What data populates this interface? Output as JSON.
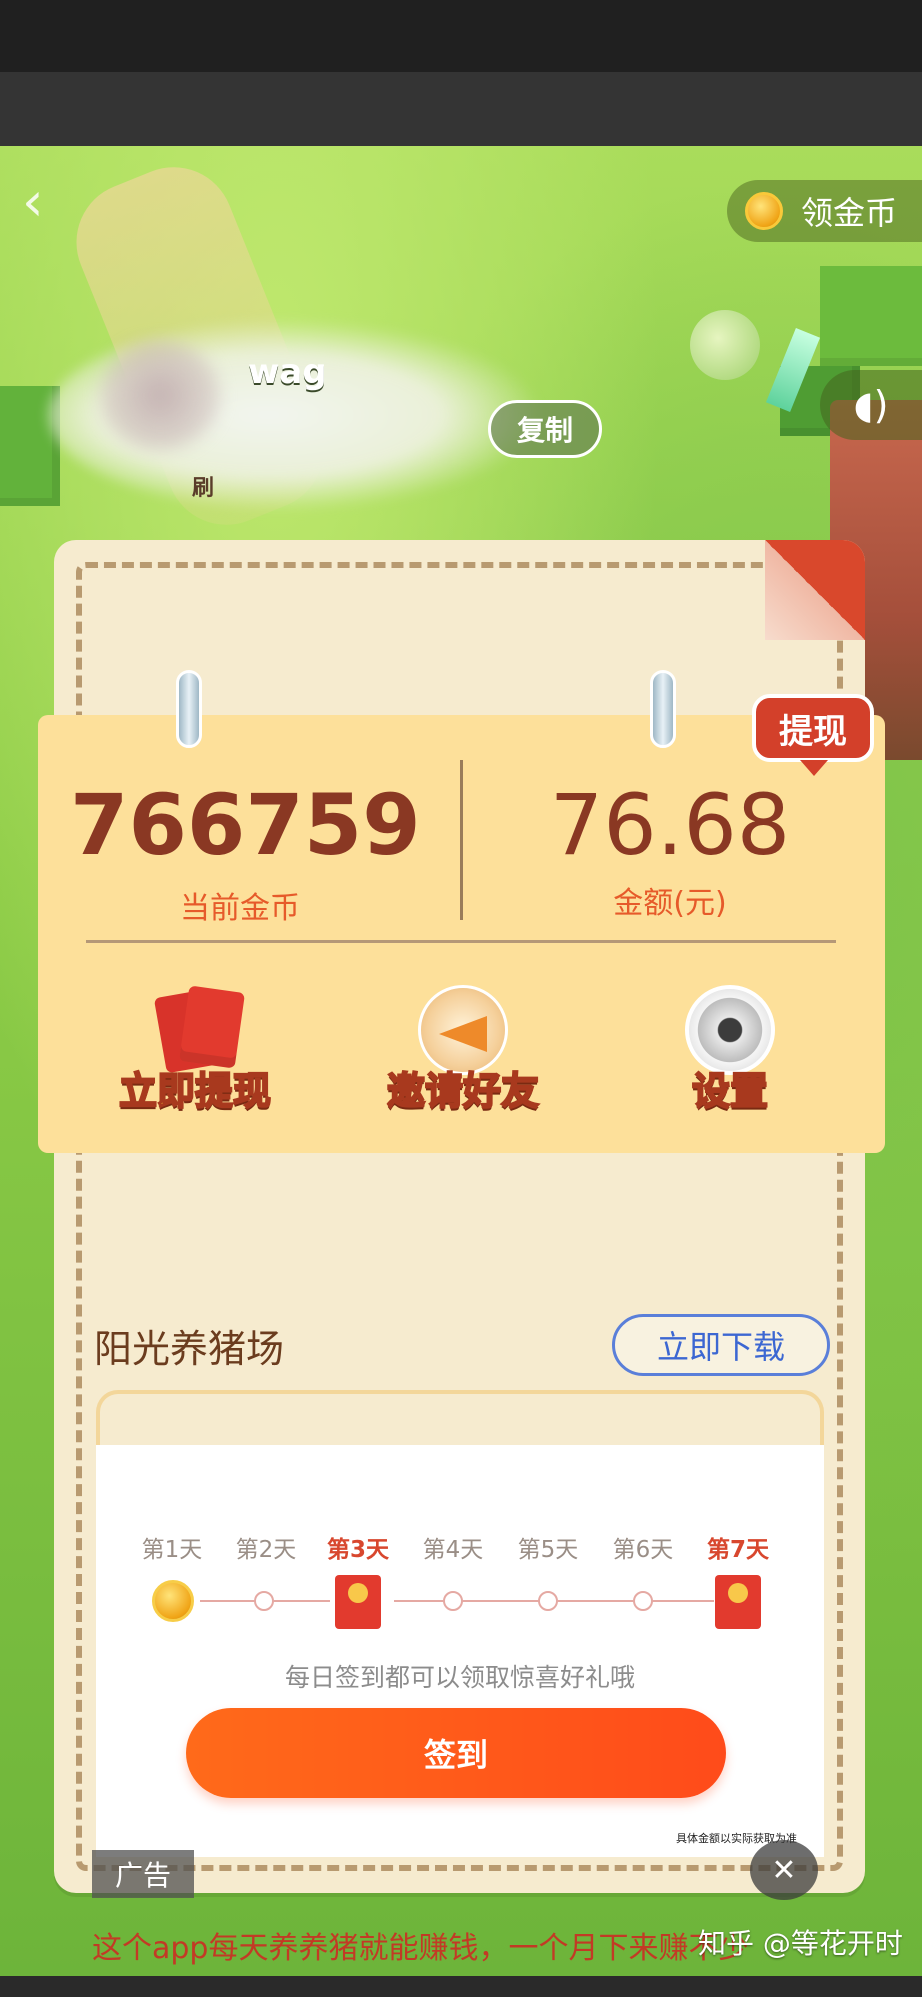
{
  "header": {
    "back_icon": "chevron-left-icon",
    "coin_button_label": "领金币",
    "sound_icon": "speaker-icon"
  },
  "user": {
    "name_fragment": "wag",
    "name_fragment2": "刷",
    "copy_label": "复制"
  },
  "wallet": {
    "coins_value": "766759",
    "coins_label": "当前金币",
    "amount_value": "76.68",
    "amount_label": "金额(元)",
    "withdraw_badge": "提现"
  },
  "actions": [
    {
      "label": "立即提现",
      "icon": "red-envelope-icon"
    },
    {
      "label": "邀请好友",
      "icon": "megaphone-icon"
    },
    {
      "label": "设置",
      "icon": "gear-icon"
    }
  ],
  "ad": {
    "app_name": "阳光养猪场",
    "download_label": "立即下载",
    "days": [
      "第1天",
      "第2天",
      "第3天",
      "第4天",
      "第5天",
      "第6天",
      "第7天"
    ],
    "highlight_days": [
      3,
      7
    ],
    "hint": "每日签到都可以领取惊喜好礼哦",
    "signin_label": "签到",
    "tiny_text": "具体金额以实际获取为准",
    "tag": "广告",
    "close_icon": "close-icon"
  },
  "caption": "这个app每天养养猪就能赚钱，一个月下来赚不少",
  "watermark": "知乎 @等花开时",
  "colors": {
    "accent_red": "#d3402a",
    "signin_orange": "#ff5a1a",
    "value_brown": "#8a3823",
    "label_orange": "#e65a2a",
    "download_blue": "#3c67d2"
  }
}
